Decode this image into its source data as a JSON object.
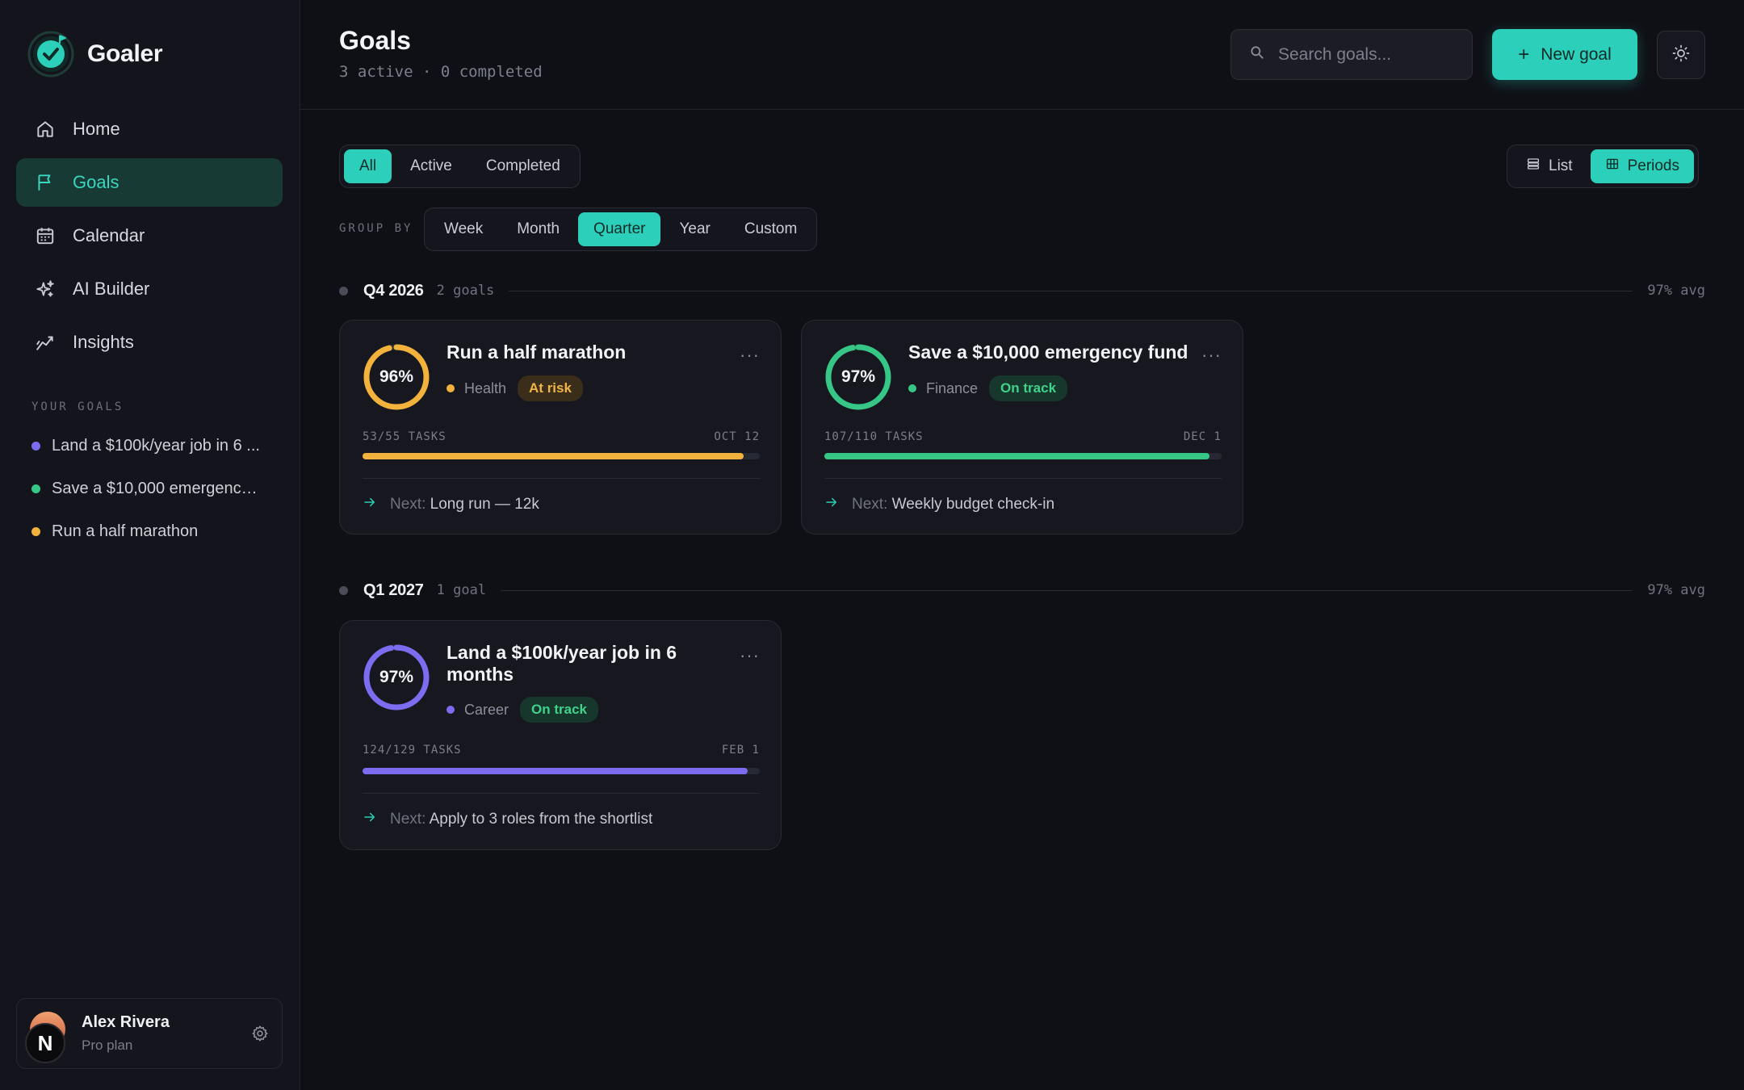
{
  "app": {
    "name": "Goaler"
  },
  "nav": [
    {
      "label": "Home",
      "icon": "home-icon",
      "active": false
    },
    {
      "label": "Goals",
      "icon": "flag-icon",
      "active": true
    },
    {
      "label": "Calendar",
      "icon": "calendar-icon",
      "active": false
    },
    {
      "label": "AI Builder",
      "icon": "sparkles-icon",
      "active": false
    },
    {
      "label": "Insights",
      "icon": "chart-line-icon",
      "active": false
    }
  ],
  "your_goals": {
    "label": "YOUR GOALS",
    "items": [
      {
        "label": "Land a $100k/year job in 6 ...",
        "color": "#7b6cf0"
      },
      {
        "label": "Save a $10,000 emergency ...",
        "color": "#36c787"
      },
      {
        "label": "Run a half marathon",
        "color": "#f2b23c"
      }
    ]
  },
  "user": {
    "name": "Alex Rivera",
    "plan": "Pro plan",
    "initial": "N"
  },
  "header": {
    "title": "Goals",
    "subtitle": "3 active · 0 completed",
    "search_placeholder": "Search goals...",
    "new_goal_label": "New goal"
  },
  "status_filter": {
    "options": [
      "All",
      "Active",
      "Completed"
    ],
    "selected": "All"
  },
  "group_by": {
    "label": "GROUP BY",
    "options": [
      "Week",
      "Month",
      "Quarter",
      "Year",
      "Custom"
    ],
    "selected": "Quarter"
  },
  "view_toggle": {
    "list_label": "List",
    "periods_label": "Periods",
    "selected": "Periods"
  },
  "periods": [
    {
      "name": "Q4 2026",
      "count": "2 goals",
      "avg": "97% avg",
      "goals": [
        {
          "title": "Run a half marathon",
          "percent_label": "96%",
          "progress": 0.96,
          "category": "Health",
          "status": "At risk",
          "status_kind": "risk",
          "color": "#f2b23c",
          "tasks": "53/55 TASKS",
          "due": "OCT 12",
          "next_label": "Next:",
          "next": "Long run — 12k"
        },
        {
          "title": "Save a $10,000 emergency fund",
          "percent_label": "97%",
          "progress": 0.97,
          "category": "Finance",
          "status": "On track",
          "status_kind": "track",
          "color": "#36c787",
          "tasks": "107/110 TASKS",
          "due": "DEC 1",
          "next_label": "Next:",
          "next": "Weekly budget check-in"
        }
      ]
    },
    {
      "name": "Q1 2027",
      "count": "1 goal",
      "avg": "97% avg",
      "goals": [
        {
          "title": "Land a $100k/year job in 6 months",
          "percent_label": "97%",
          "progress": 0.97,
          "category": "Career",
          "status": "On track",
          "status_kind": "track",
          "color": "#7b6cf0",
          "tasks": "124/129 TASKS",
          "due": "FEB 1",
          "next_label": "Next:",
          "next": "Apply to 3 roles from the shortlist"
        }
      ]
    }
  ]
}
